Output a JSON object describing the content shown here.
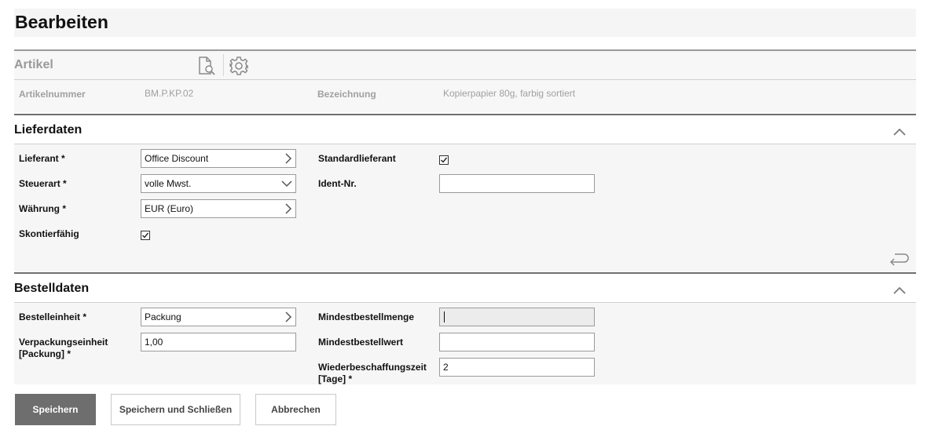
{
  "page": {
    "title": "Bearbeiten"
  },
  "artikel": {
    "section_label": "Artikel",
    "artikelnummer_label": "Artikelnummer",
    "artikelnummer_value": "BM.P.KP.02",
    "bezeichnung_label": "Bezeichnung",
    "bezeichnung_value": "Kopierpapier 80g, farbig sortiert",
    "icons": [
      "document-search-icon",
      "gear-icon"
    ]
  },
  "lieferdaten": {
    "title": "Lieferdaten",
    "lieferant": {
      "label": "Lieferant *",
      "value": "Office Discount",
      "icon": "chevron-right-icon"
    },
    "steuerart": {
      "label": "Steuerart *",
      "value": "volle Mwst.",
      "icon": "chevron-down-icon"
    },
    "waehrung": {
      "label": "Währung *",
      "value": "EUR (Euro)",
      "icon": "chevron-right-icon"
    },
    "skontierfaehig": {
      "label": "Skontierfähig",
      "checked": true
    },
    "standardlieferant": {
      "label": "Standardlieferant",
      "checked": true
    },
    "ident_nr": {
      "label": "Ident-Nr.",
      "value": ""
    },
    "return_icon": "return-arrow-icon"
  },
  "bestelldaten": {
    "title": "Bestelldaten",
    "bestelleinheit": {
      "label": "Bestelleinheit *",
      "value": "Packung",
      "icon": "chevron-right-icon"
    },
    "verpackungseinheit": {
      "label_line1": "Verpackungseinheit",
      "label_line2": "[Packung] *",
      "value": "1,00"
    },
    "mindestbestellmenge": {
      "label": "Mindestbestellmenge",
      "value": ""
    },
    "mindestbestellwert": {
      "label": "Mindestbestellwert",
      "value": ""
    },
    "wiederbeschaffungszeit": {
      "label_line1": "Wiederbeschaffungszeit",
      "label_line2": "[Tage] *",
      "value": "2"
    }
  },
  "buttons": {
    "save": "Speichern",
    "save_close": "Speichern und Schließen",
    "cancel": "Abbrechen"
  },
  "colors": {
    "primary_button": "#6e6e6e",
    "section_line": "#6f6f6f",
    "panel_background": "#f6f6f6"
  }
}
